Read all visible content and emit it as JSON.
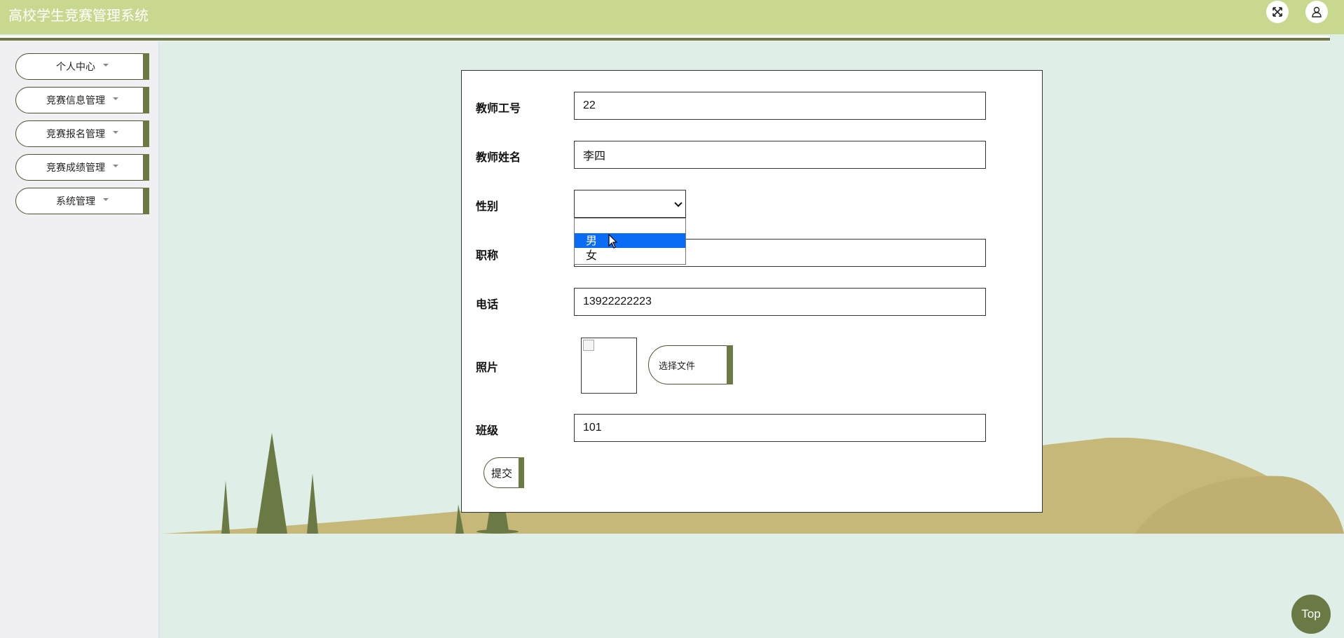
{
  "header": {
    "title": "高校学生竞赛管理系统",
    "fullscreen_icon": "expand-icon",
    "user_icon": "user-icon"
  },
  "sidebar": {
    "items": [
      {
        "label": "个人中心"
      },
      {
        "label": "竞赛信息管理"
      },
      {
        "label": "竞赛报名管理"
      },
      {
        "label": "竞赛成绩管理"
      },
      {
        "label": "系统管理"
      }
    ]
  },
  "form": {
    "teacher_id": {
      "label": "教师工号",
      "value": "22"
    },
    "teacher_name": {
      "label": "教师姓名",
      "value": "李四"
    },
    "gender": {
      "label": "性别",
      "value": "",
      "options": [
        "",
        "男",
        "女"
      ],
      "highlighted": "男"
    },
    "title": {
      "label": "职称",
      "value": ""
    },
    "phone": {
      "label": "电话",
      "value": "13922222223"
    },
    "photo": {
      "label": "照片",
      "choose_file": "选择文件"
    },
    "class": {
      "label": "班级",
      "value": "101"
    },
    "submit_label": "提交"
  },
  "top_button": "Top",
  "colors": {
    "header": "#c8d98f",
    "accent": "#6b7a45",
    "background": "#dfeee6",
    "hill": "#c6b878",
    "tree": "#6b7a45",
    "selected_option": "#0a6cf5"
  }
}
